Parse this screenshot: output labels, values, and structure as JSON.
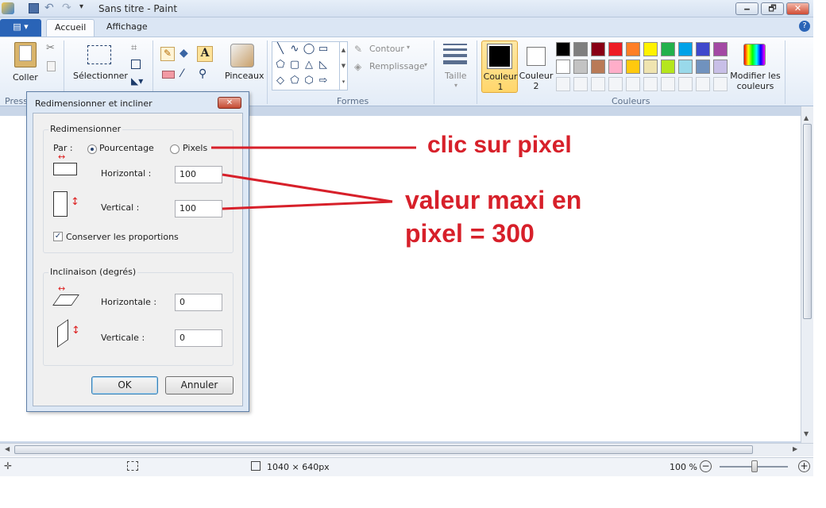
{
  "window": {
    "title": "Sans titre - Paint",
    "min": "🗕",
    "max": "🗗",
    "close": "✕"
  },
  "tabs": {
    "file": "▤ ▾",
    "home": "Accueil",
    "view": "Affichage",
    "help": "?"
  },
  "ribbon": {
    "paste": "Coller",
    "clipboard_group": "Presse",
    "select": "Sélectionner",
    "brushes": "Pinceaux",
    "outline": "Contour",
    "fill": "Remplissage",
    "shapes_group": "Formes",
    "size": "Taille",
    "color1_line1": "Couleur",
    "color1_line2": "1",
    "color2_line1": "Couleur",
    "color2_line2": "2",
    "edit_colors_line1": "Modifier les",
    "edit_colors_line2": "couleurs",
    "colors_group": "Couleurs",
    "palette_row1": [
      "#000000",
      "#7f7f7f",
      "#880015",
      "#ed1c24",
      "#ff7f27",
      "#fff200",
      "#22b14c",
      "#00a2e8",
      "#3f48cc",
      "#a349a4"
    ],
    "palette_row2": [
      "#ffffff",
      "#c3c3c3",
      "#b97a57",
      "#ffaec9",
      "#ffc90e",
      "#efe4b0",
      "#b5e61d",
      "#99d9ea",
      "#7092be",
      "#c8bfe7"
    ]
  },
  "dialog": {
    "title": "Redimensionner et incliner",
    "close": "✕",
    "resize_section": "Redimensionner",
    "by_label": "Par :",
    "percent_option": "Pourcentage",
    "pixels_option": "Pixels",
    "horizontal_label": "Horizontal :",
    "horizontal_value": "100",
    "vertical_label": "Vertical :",
    "vertical_value": "100",
    "keep_ratio": "Conserver les proportions",
    "skew_section": "Inclinaison (degrés)",
    "skew_h_label": "Horizontale :",
    "skew_h_value": "0",
    "skew_v_label": "Verticale :",
    "skew_v_value": "0",
    "ok": "OK",
    "cancel": "Annuler"
  },
  "annotations": {
    "click_pixel": "clic sur pixel",
    "max_line1": "valeur maxi en",
    "max_line2": "pixel = 300",
    "color": "#d7202a"
  },
  "status": {
    "dimensions": "1040 × 640px",
    "zoom": "100 %"
  }
}
